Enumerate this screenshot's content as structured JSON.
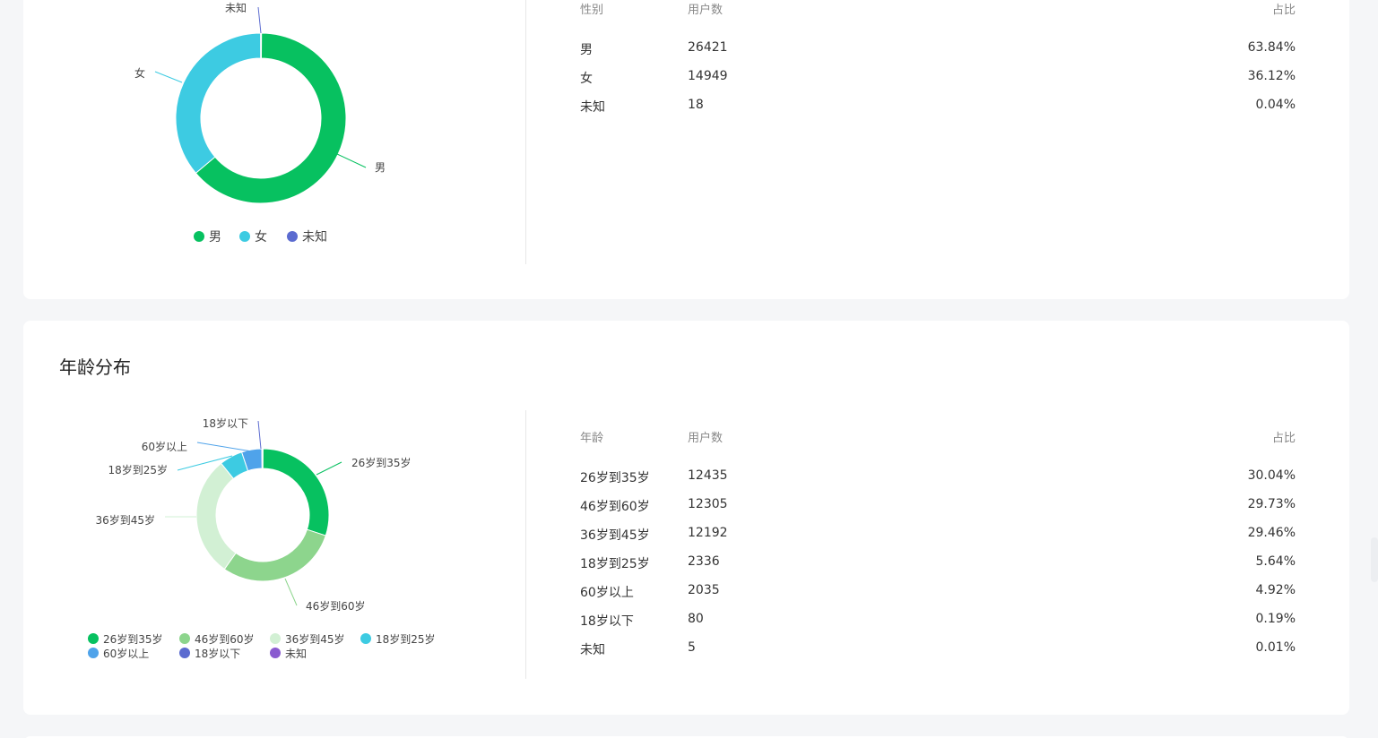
{
  "colors": {
    "green": "#07c160",
    "cyan": "#3dcbe2",
    "indigo": "#5b6bd0",
    "light_green": "#8dd58d",
    "pale_green": "#d2f0d4",
    "blue": "#4fa3ea",
    "purple": "#8a5bd0"
  },
  "gender": {
    "table": {
      "headers": [
        "性别",
        "用户数",
        "占比"
      ],
      "rows": [
        [
          "男",
          "26421",
          "63.84%"
        ],
        [
          "女",
          "14949",
          "36.12%"
        ],
        [
          "未知",
          "18",
          "0.04%"
        ]
      ]
    },
    "legend": [
      "男",
      "女",
      "未知"
    ],
    "chart_data": {
      "type": "pie",
      "categories": [
        "男",
        "女",
        "未知"
      ],
      "values": [
        26421,
        14949,
        18
      ],
      "legend_position": "bottom"
    }
  },
  "age": {
    "title": "年龄分布",
    "table": {
      "headers": [
        "年龄",
        "用户数",
        "占比"
      ],
      "rows": [
        [
          "26岁到35岁",
          "12435",
          "30.04%"
        ],
        [
          "46岁到60岁",
          "12305",
          "29.73%"
        ],
        [
          "36岁到45岁",
          "12192",
          "29.46%"
        ],
        [
          "18岁到25岁",
          "2336",
          "5.64%"
        ],
        [
          "60岁以上",
          "2035",
          "4.92%"
        ],
        [
          "18岁以下",
          "80",
          "0.19%"
        ],
        [
          "未知",
          "5",
          "0.01%"
        ]
      ]
    },
    "legend": [
      "26岁到35岁",
      "46岁到60岁",
      "36岁到45岁",
      "18岁到25岁",
      "60岁以上",
      "18岁以下",
      "未知"
    ],
    "chart_data": {
      "type": "pie",
      "categories": [
        "26岁到35岁",
        "46岁到60岁",
        "36岁到45岁",
        "18岁到25岁",
        "60岁以上",
        "18岁以下",
        "未知"
      ],
      "values": [
        12435,
        12305,
        12192,
        2336,
        2035,
        80,
        5
      ],
      "legend_position": "bottom"
    }
  }
}
